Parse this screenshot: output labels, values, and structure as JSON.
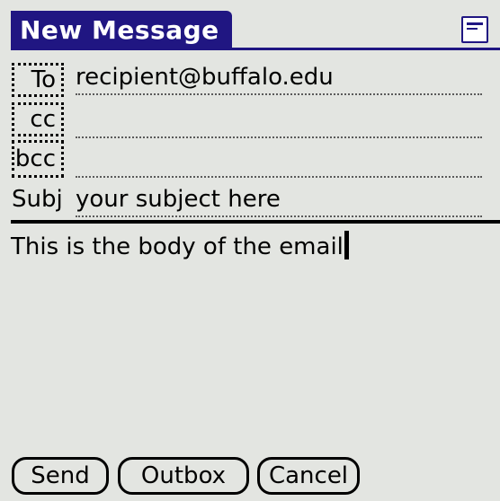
{
  "window": {
    "title": "New Message"
  },
  "icons": {
    "menu": "menu-icon"
  },
  "colors": {
    "title_bar": "#201682",
    "background": "#e3e5e1",
    "text": "#000000"
  },
  "fields": {
    "to": {
      "label": "To",
      "value": "recipient@buffalo.edu"
    },
    "cc": {
      "label": "cc",
      "value": ""
    },
    "bcc": {
      "label": "bcc",
      "value": ""
    },
    "subject": {
      "label": "Subj",
      "value": "your subject here"
    }
  },
  "body": {
    "text": "This is the body of the email"
  },
  "buttons": {
    "send": "Send",
    "outbox": "Outbox",
    "cancel": "Cancel"
  }
}
